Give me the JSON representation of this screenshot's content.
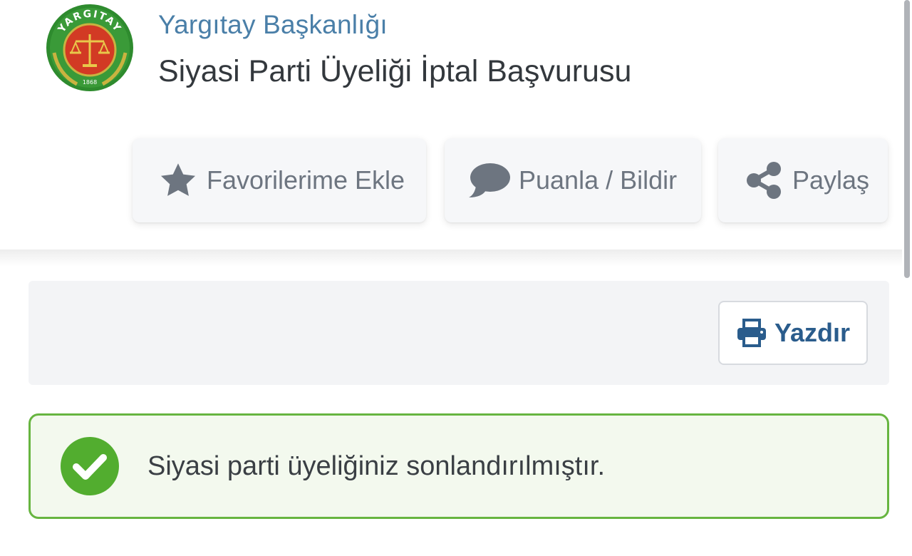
{
  "header": {
    "institution": "Yargıtay Başkanlığı",
    "service_title": "Siyasi Parti Üyeliği İptal Başvurusu",
    "logo": {
      "icon": "yargitay-emblem",
      "text": "YARGITAY",
      "year": "1868"
    }
  },
  "actions": {
    "favorite": {
      "label": "Favorilerime Ekle",
      "icon": "star-icon"
    },
    "rate": {
      "label": "Puanla / Bildir",
      "icon": "speech-bubble-icon"
    },
    "share": {
      "label": "Paylaş",
      "icon": "share-icon"
    }
  },
  "print": {
    "label": "Yazdır",
    "icon": "printer-icon"
  },
  "alert": {
    "message": "Siyasi parti üyeliğiniz sonlandırılmıştır.",
    "icon": "check-circle-icon",
    "status": "success"
  },
  "colors": {
    "institution_blue": "#4a7fa8",
    "print_blue": "#2a5c8c",
    "success_green": "#67b540",
    "success_bg": "#f3f9ee",
    "icon_gray": "#6d7580"
  }
}
